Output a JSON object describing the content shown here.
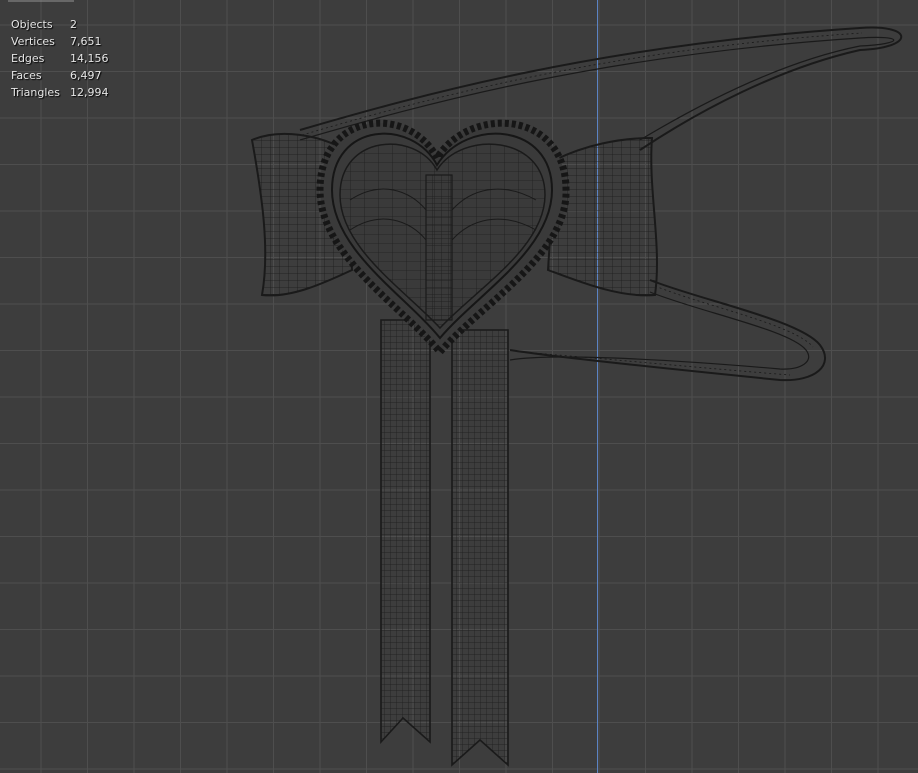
{
  "viewport": {
    "mode": "wireframe",
    "background": "#3d3d3d",
    "grid_color": "#4e4e4e",
    "axis_color": "#5b83c4"
  },
  "stats": [
    {
      "label": "Objects",
      "value": "2"
    },
    {
      "label": "Vertices",
      "value": "7,651"
    },
    {
      "label": "Edges",
      "value": "14,156"
    },
    {
      "label": "Faces",
      "value": "6,497"
    },
    {
      "label": "Triangles",
      "value": "12,994"
    }
  ]
}
